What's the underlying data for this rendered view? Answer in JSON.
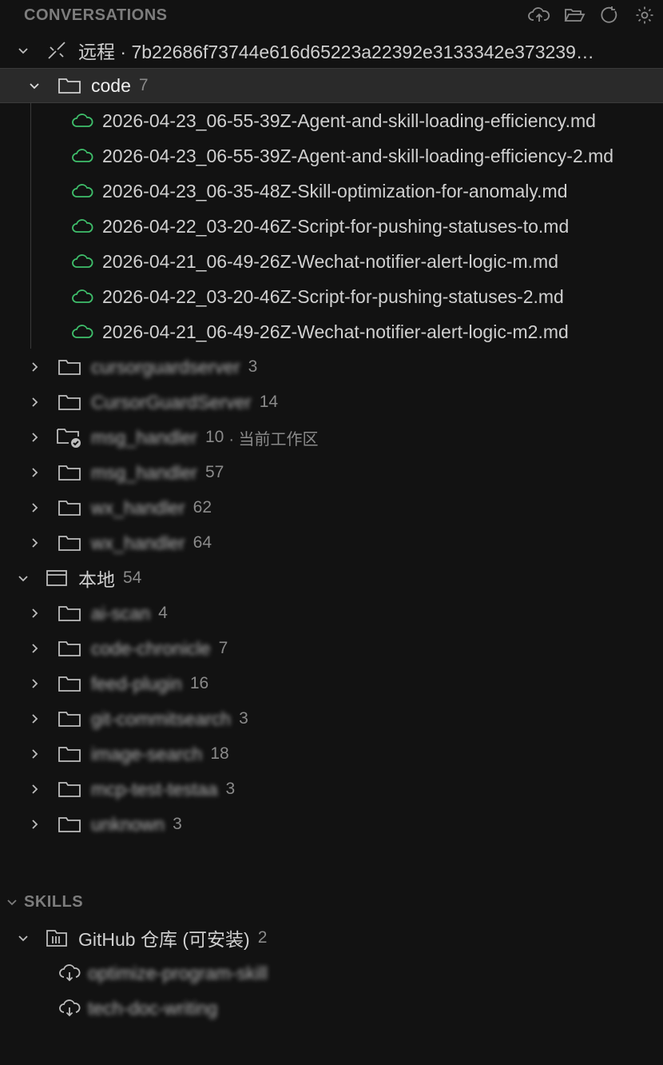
{
  "conversations": {
    "header": "CONVERSATIONS",
    "actions": [
      {
        "icon": "cloud-upload-icon"
      },
      {
        "icon": "folder-open-icon"
      },
      {
        "icon": "refresh-icon"
      },
      {
        "icon": "settings-gear-icon"
      }
    ],
    "remote": {
      "label": "远程 · 7b22686f73744e616d65223a22392e3133342e373239…",
      "icon": "remote-connection-icon"
    },
    "code_folder": {
      "label": "code",
      "count": "7",
      "files": [
        "2026-04-23_06-55-39Z-Agent-and-skill-loading-efficiency.md",
        "2026-04-23_06-55-39Z-Agent-and-skill-loading-efficiency-2.md",
        "2026-04-23_06-35-48Z-Skill-optimization-for-anomaly.md",
        "2026-04-22_03-20-46Z-Script-for-pushing-statuses-to.md",
        "2026-04-21_06-49-26Z-Wechat-notifier-alert-logic-m.md",
        "2026-04-22_03-20-46Z-Script-for-pushing-statuses-2.md",
        "2026-04-21_06-49-26Z-Wechat-notifier-alert-logic-m2.md"
      ]
    },
    "remote_folders": [
      {
        "label": "cursorguardserver",
        "count": "3",
        "blurred": true
      },
      {
        "label": "CursorGuardServer",
        "count": "14",
        "blurred": true
      },
      {
        "label": "msg_handler",
        "count": "10",
        "suffix": "· 当前工作区",
        "blurred": true,
        "current": true
      },
      {
        "label": "msg_handler",
        "count": "57",
        "blurred": true
      },
      {
        "label": "wx_handler",
        "count": "62",
        "blurred": true
      },
      {
        "label": "wx_handler",
        "count": "64",
        "blurred": true
      }
    ],
    "local": {
      "label": "本地",
      "count": "54",
      "folders": [
        {
          "label": "ai-scan",
          "count": "4"
        },
        {
          "label": "code-chronicle",
          "count": "7"
        },
        {
          "label": "feed-plugin",
          "count": "16"
        },
        {
          "label": "git-commitsearch",
          "count": "3"
        },
        {
          "label": "image-search",
          "count": "18"
        },
        {
          "label": "mcp-test-testaa",
          "count": "3"
        },
        {
          "label": "unknown",
          "count": "3"
        }
      ]
    }
  },
  "skills": {
    "header": "SKILLS",
    "repo": {
      "label": "GitHub 仓库 (可安装)",
      "count": "2"
    },
    "items": [
      {
        "label": "optimize-program-skill",
        "icon": "cloud-download-icon"
      },
      {
        "label": "tech-doc-writing",
        "icon": "cloud-download-icon"
      }
    ]
  },
  "colors": {
    "background": "#121212",
    "selected_row": "#2a2a2a",
    "cloud_green": "#3fbf6b",
    "text": "#d0d0d0",
    "muted": "#8a8a8a"
  }
}
